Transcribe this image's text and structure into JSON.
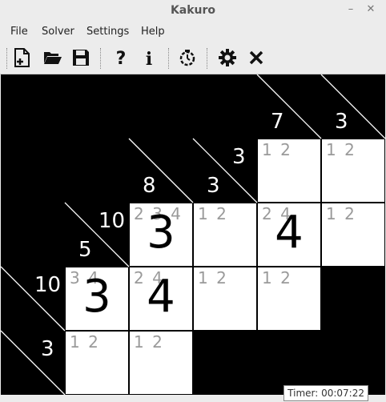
{
  "window": {
    "title": "Kakuro"
  },
  "menu": {
    "file": "File",
    "solver": "Solver",
    "settings": "Settings",
    "help": "Help"
  },
  "status": {
    "timer": "Timer: 00:07:22"
  },
  "board": {
    "clues": [
      {
        "id": "r0c4-down",
        "text": "7"
      },
      {
        "id": "r0c5-down",
        "text": "3"
      },
      {
        "id": "r1c3-down",
        "text": "3"
      },
      {
        "id": "r2c2-down",
        "text": "8"
      },
      {
        "id": "r2c3-down",
        "text": "3"
      },
      {
        "id": "r2c1-across",
        "text": "10"
      },
      {
        "id": "r3c1-down",
        "text": "5"
      },
      {
        "id": "r3c0-across",
        "text": "10"
      },
      {
        "id": "r4c0-across",
        "text": "3"
      }
    ],
    "cells": {
      "r1c4": {
        "cand": "1 2",
        "value": ""
      },
      "r1c5": {
        "cand": "1 2",
        "value": ""
      },
      "r2c2": {
        "cand": "2 3 4",
        "value": "3"
      },
      "r2c3": {
        "cand": "1 2",
        "value": ""
      },
      "r2c4": {
        "cand": "2 4",
        "value": "4"
      },
      "r2c5": {
        "cand": "1 2",
        "value": ""
      },
      "r3c1": {
        "cand": "3 4",
        "value": "3"
      },
      "r3c2": {
        "cand": "2 4",
        "value": "4"
      },
      "r3c3": {
        "cand": "1 2",
        "value": ""
      },
      "r3c4": {
        "cand": "1 2",
        "value": ""
      },
      "r4c1": {
        "cand": "1 2",
        "value": ""
      },
      "r4c2": {
        "cand": "1 2",
        "value": ""
      }
    }
  }
}
